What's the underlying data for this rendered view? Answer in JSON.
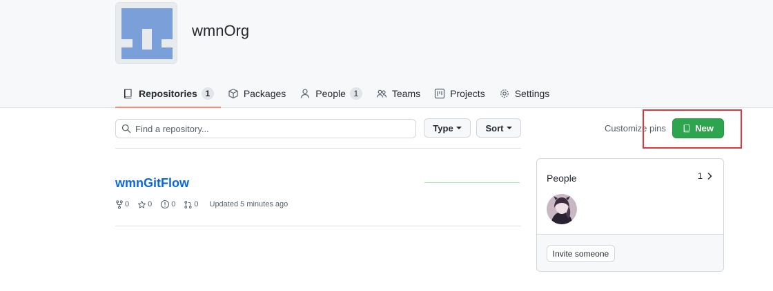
{
  "org": {
    "name": "wmnOrg",
    "avatar_icon": "org-identicon",
    "avatar_color": "#7b9fd9"
  },
  "tabs": [
    {
      "label": "Repositories",
      "count": "1",
      "icon": "repo-icon",
      "selected": true
    },
    {
      "label": "Packages",
      "icon": "package-icon"
    },
    {
      "label": "People",
      "count": "1",
      "icon": "person-icon"
    },
    {
      "label": "Teams",
      "icon": "people-icon"
    },
    {
      "label": "Projects",
      "icon": "project-icon"
    },
    {
      "label": "Settings",
      "icon": "gear-icon"
    }
  ],
  "search": {
    "placeholder": "Find a repository..."
  },
  "filters": {
    "type_label": "Type",
    "sort_label": "Sort"
  },
  "actions": {
    "customize_label": "Customize pins",
    "new_label": "New",
    "new_color": "#2da44e",
    "highlight_color": "#e0363b"
  },
  "repos": [
    {
      "name": "wmnGitFlow",
      "forks": "0",
      "stars": "0",
      "issues": "0",
      "pulls": "0",
      "updated": "Updated 5 minutes ago"
    }
  ],
  "people": {
    "title": "People",
    "count": "1",
    "invite_label": "Invite someone"
  }
}
